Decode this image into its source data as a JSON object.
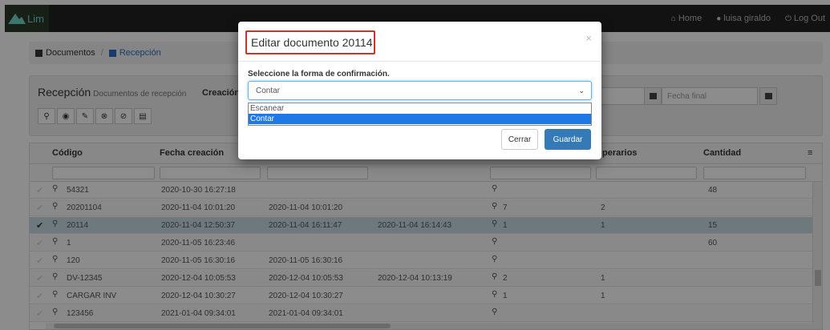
{
  "navbar": {
    "brand": "Lim",
    "home": "Home",
    "user": "luisa giraldo",
    "logout": "Log Out"
  },
  "breadcrumb": {
    "item1": "Documentos",
    "item2": "Recepción"
  },
  "panel": {
    "title": "Recepción",
    "subtitle": "Documentos de recepción",
    "creacion": "Creación",
    "fecha_final_placeholder": "Fecha final"
  },
  "grid": {
    "headers": [
      "Código",
      "Fecha creación",
      "perarios",
      "Cantidad"
    ],
    "rows": [
      {
        "codigo": "54321",
        "fecha": "2020-10-30 16:27:18",
        "c3": "",
        "c4": "",
        "c5": "",
        "c6": "",
        "cant": "48",
        "checked": false
      },
      {
        "codigo": "20201104",
        "fecha": "2020-11-04 10:01:20",
        "c3": "2020-11-04 10:01:20",
        "c4": "",
        "c5": "7",
        "c6": "2",
        "cant": "",
        "checked": false
      },
      {
        "codigo": "20114",
        "fecha": "2020-11-04 12:50:37",
        "c3": "2020-11-04 16:11:47",
        "c4": "2020-11-04 16:14:43",
        "c5": "1",
        "c6": "1",
        "cant": "15",
        "checked": true
      },
      {
        "codigo": "1",
        "fecha": "2020-11-05 16:23:46",
        "c3": "",
        "c4": "",
        "c5": "",
        "c6": "",
        "cant": "60",
        "checked": false
      },
      {
        "codigo": "120",
        "fecha": "2020-11-05 16:30:16",
        "c3": "2020-11-05 16:30:16",
        "c4": "",
        "c5": "",
        "c6": "",
        "cant": "",
        "checked": false
      },
      {
        "codigo": "DV-12345",
        "fecha": "2020-12-04 10:05:53",
        "c3": "2020-12-04 10:05:53",
        "c4": "2020-12-04 10:13:19",
        "c5": "2",
        "c6": "1",
        "cant": "",
        "checked": false
      },
      {
        "codigo": "CARGAR INV",
        "fecha": "2020-12-04 10:30:27",
        "c3": "2020-12-04 10:30:27",
        "c4": "",
        "c5": "1",
        "c6": "1",
        "cant": "",
        "checked": false
      },
      {
        "codigo": "123456",
        "fecha": "2021-01-04 09:34:01",
        "c3": "2021-01-04 09:34:01",
        "c4": "",
        "c5": "",
        "c6": "",
        "cant": "",
        "checked": false
      }
    ]
  },
  "modal": {
    "title": "Editar documento 20114",
    "close": "×",
    "label": "Seleccione la forma de confirmación.",
    "selected": "Contar",
    "options": [
      "Escanear",
      "Contar"
    ],
    "cerrar": "Cerrar",
    "guardar": "Guardar"
  }
}
